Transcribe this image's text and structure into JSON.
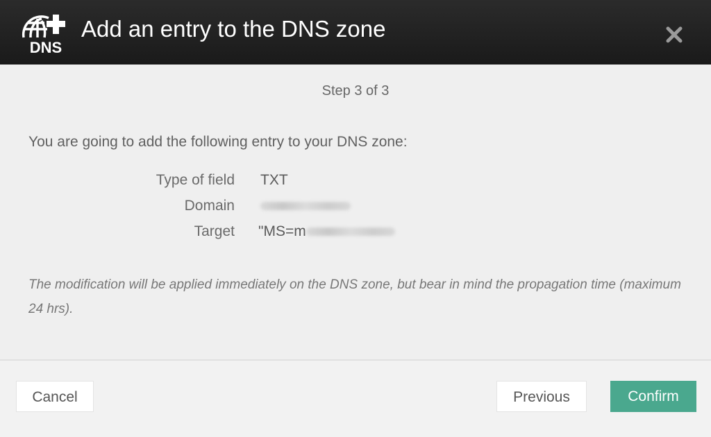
{
  "dialog": {
    "title": "Add an entry to the DNS zone",
    "logo_text": "DNS",
    "close_icon": "close-icon"
  },
  "step": "Step 3 of 3",
  "intro": "You are going to add the following entry to your DNS zone:",
  "entry": {
    "type_label": "Type of field",
    "type_value": "TXT",
    "domain_label": "Domain",
    "target_label": "Target",
    "target_prefix": "\"MS=m"
  },
  "note": "The modification will be applied immediately on the DNS zone, but bear in mind the propagation time (maximum 24 hrs).",
  "buttons": {
    "cancel": "Cancel",
    "previous": "Previous",
    "confirm": "Confirm"
  },
  "colors": {
    "header": "#1f1f1f",
    "confirm": "#4aa88e"
  }
}
